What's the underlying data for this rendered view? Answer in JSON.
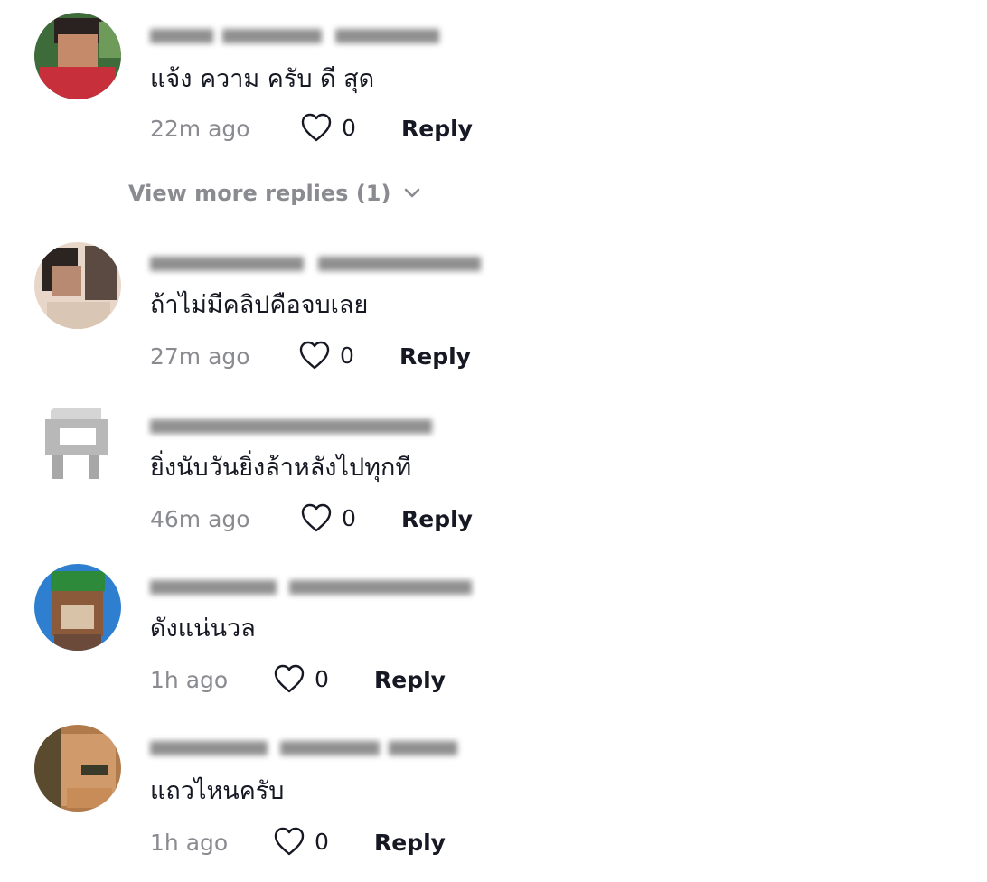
{
  "comments": [
    {
      "text": "แจ้ง ความ ครับ ดี สุด",
      "time": "22m ago",
      "likes": "0",
      "reply_label": "Reply",
      "avatar_colors": [
        "#3d6b3a",
        "#c72f3b",
        "#2a2220",
        "#c48a6a",
        "#6e9a5a"
      ]
    },
    {
      "text": "ถ้าไม่มีคลิปคือจบเลย",
      "time": "27m ago",
      "likes": "0",
      "reply_label": "Reply",
      "avatar_colors": [
        "#e8d6c8",
        "#2b2421",
        "#b98a72",
        "#d9c6b4",
        "#5a4a42"
      ]
    },
    {
      "text": "ยิ่งนับวันยิ่งล้าหลังไปทุกที",
      "time": "46m ago",
      "likes": "0",
      "reply_label": "Reply",
      "avatar_colors": [
        "#ffffff",
        "#9a9a9a",
        "#d5d5d5",
        "#6c6c6c",
        "#ffffff"
      ]
    },
    {
      "text": "ดังแน่นวล",
      "time": "1h ago",
      "likes": "0",
      "reply_label": "Reply",
      "avatar_colors": [
        "#2f7fd0",
        "#6b4a3a",
        "#d8c2a8",
        "#2c8a3a",
        "#8a5a3a"
      ]
    },
    {
      "text": "แถวไหนครับ",
      "time": "1h ago",
      "likes": "0",
      "reply_label": "Reply",
      "avatar_colors": [
        "#b07a4a",
        "#5a4a2e",
        "#d09a6a",
        "#3a3a2a",
        "#c88c58"
      ]
    }
  ],
  "view_more": {
    "label": "View more replies (1)"
  },
  "icons": {
    "like": "heart-outline-icon",
    "expand": "chevron-down-icon"
  },
  "colors": {
    "text_primary": "#161823",
    "text_secondary": "#8a8b91"
  }
}
